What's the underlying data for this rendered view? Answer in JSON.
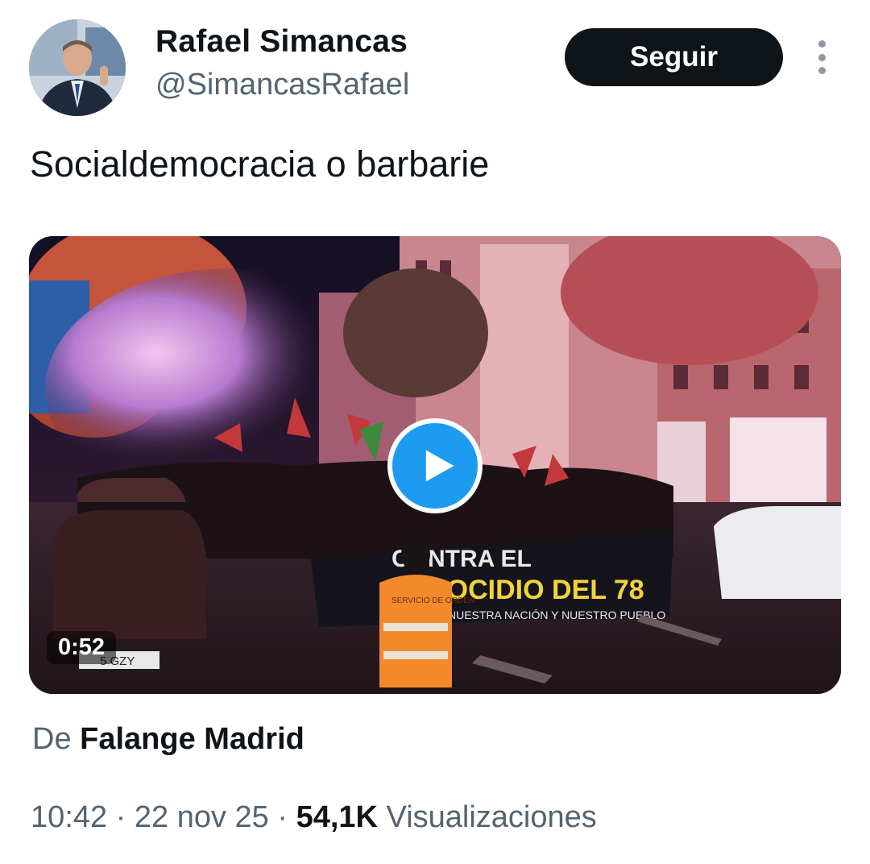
{
  "author": {
    "name": "Rafael Simancas",
    "handle": "@SimancasRafael"
  },
  "follow_label": "Seguir",
  "tweet_text": "Socialdemocracia o barbarie",
  "media": {
    "duration": "0:52",
    "banner_line1": "CONTRA EL",
    "banner_line2": "GENOCIDIO DEL 78",
    "banner_line3": "NUESTRA NACIÓN Y NUESTRO PUEBLO",
    "vest_text": "SERVICIO DE ORDEN",
    "plate_text": "5 GZY"
  },
  "attribution": {
    "prefix": "De",
    "source": "Falange Madrid"
  },
  "meta": {
    "time": "10:42",
    "separator": "·",
    "date": "22 nov 25",
    "views_count": "54,1K",
    "views_label": "Visualizaciones"
  },
  "colors": {
    "follow_bg": "#0f1419",
    "play_button": "#1d9bf0",
    "secondary_text": "#536471"
  }
}
